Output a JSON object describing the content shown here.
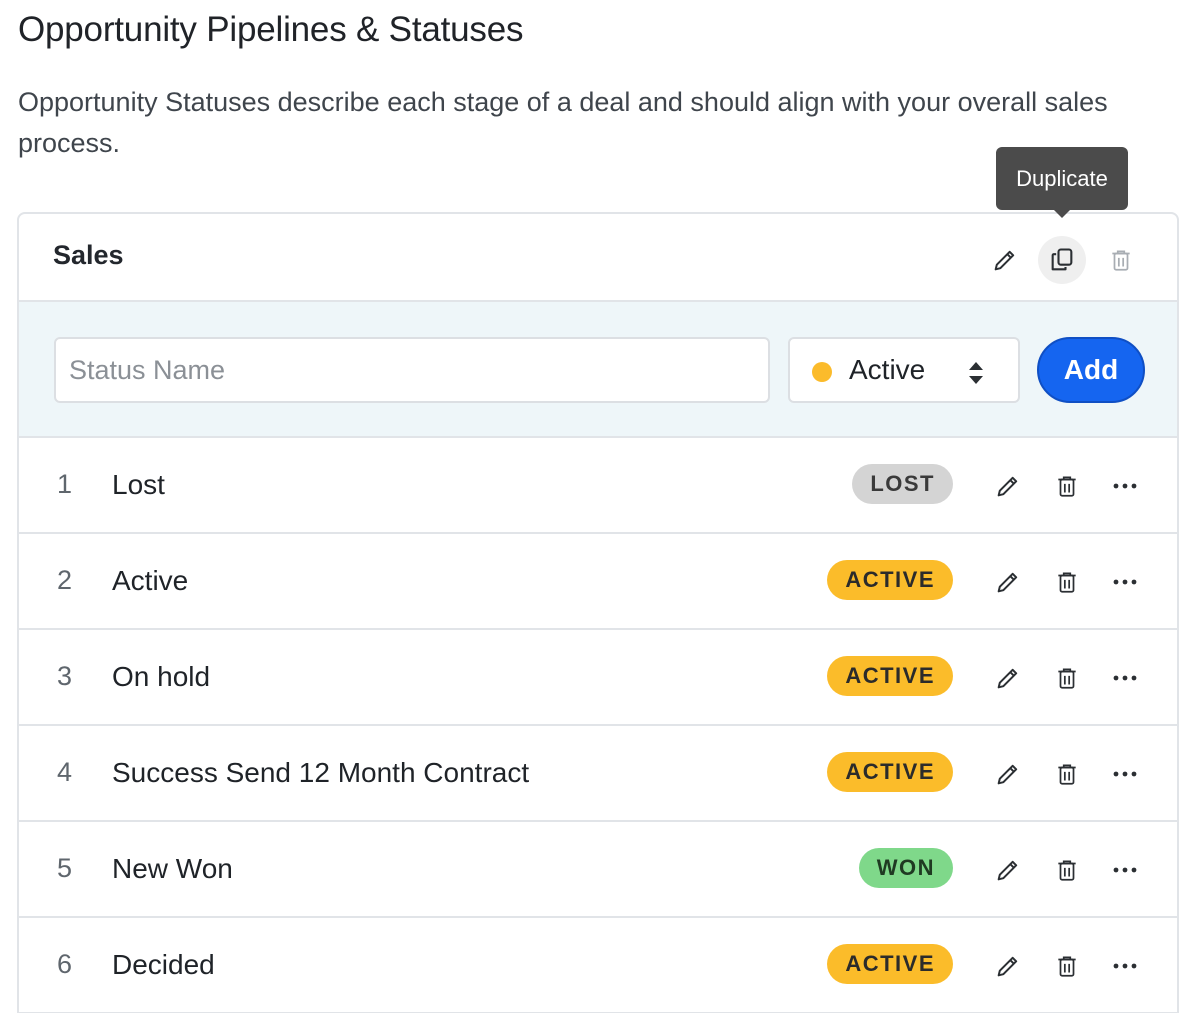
{
  "page": {
    "title": "Opportunity Pipelines & Statuses",
    "description": "Opportunity Statuses describe each stage of a deal and should align with your overall sales process."
  },
  "tooltip": {
    "text": "Duplicate"
  },
  "pipeline": {
    "name": "Sales",
    "header_icons": [
      "pencil-icon",
      "duplicate-icon",
      "trash-icon"
    ]
  },
  "add_form": {
    "input_placeholder": "Status Name",
    "input_value": "",
    "select_value": "Active",
    "select_dot_color": "#fbbb2b",
    "add_label": "Add"
  },
  "statuses": [
    {
      "num": "1",
      "name": "Lost",
      "badge": "LOST",
      "type": "lost"
    },
    {
      "num": "2",
      "name": "Active",
      "badge": "ACTIVE",
      "type": "active"
    },
    {
      "num": "3",
      "name": "On hold",
      "badge": "ACTIVE",
      "type": "active"
    },
    {
      "num": "4",
      "name": "Success Send 12 Month Contract",
      "badge": "ACTIVE",
      "type": "active"
    },
    {
      "num": "5",
      "name": "New Won",
      "badge": "WON",
      "type": "won"
    },
    {
      "num": "6",
      "name": "Decided",
      "badge": "ACTIVE",
      "type": "active"
    }
  ],
  "colors": {
    "accent": "#1565f0",
    "lost": "#d4d4d4",
    "active": "#fbbc2a",
    "won": "#7fd88a",
    "form_bg": "#eef6f9"
  }
}
